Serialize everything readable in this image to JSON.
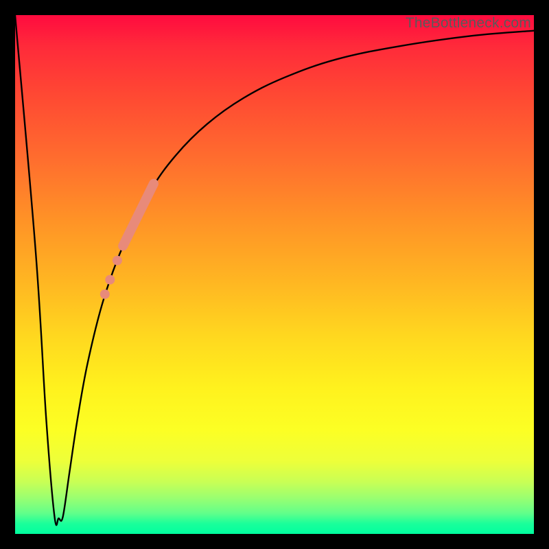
{
  "watermark": "TheBottleneck.com",
  "chart_data": {
    "type": "line",
    "title": "",
    "xlabel": "",
    "ylabel": "",
    "xlim": [
      0,
      100
    ],
    "ylim": [
      0,
      100
    ],
    "series": [
      {
        "name": "bottleneck-curve",
        "x": [
          0,
          4,
          6,
          7.6,
          8.4,
          9.2,
          10.5,
          12,
          14,
          17,
          21,
          26,
          31,
          37,
          44,
          52,
          62,
          74,
          88,
          100
        ],
        "values": [
          100,
          54,
          22,
          3.3,
          3.0,
          3.3,
          12,
          22,
          33,
          45,
          56,
          66,
          73,
          79,
          84,
          88,
          91.5,
          94,
          96,
          97
        ]
      }
    ],
    "markers": {
      "name": "highlight-dots",
      "color": "#e88a7a",
      "points": [
        {
          "x": 17.3,
          "y": 46.2,
          "r": 7
        },
        {
          "x": 18.3,
          "y": 49.0,
          "r": 7
        },
        {
          "x": 19.7,
          "y": 52.7,
          "r": 7
        }
      ],
      "segment": {
        "x1": 20.8,
        "y1": 55.5,
        "x2": 26.7,
        "y2": 67.5,
        "width": 14
      }
    },
    "colors": {
      "curve_stroke": "#000000",
      "marker_fill": "#e88a7a",
      "background_top": "#ff0b3f",
      "background_bottom": "#00ff9f"
    }
  }
}
